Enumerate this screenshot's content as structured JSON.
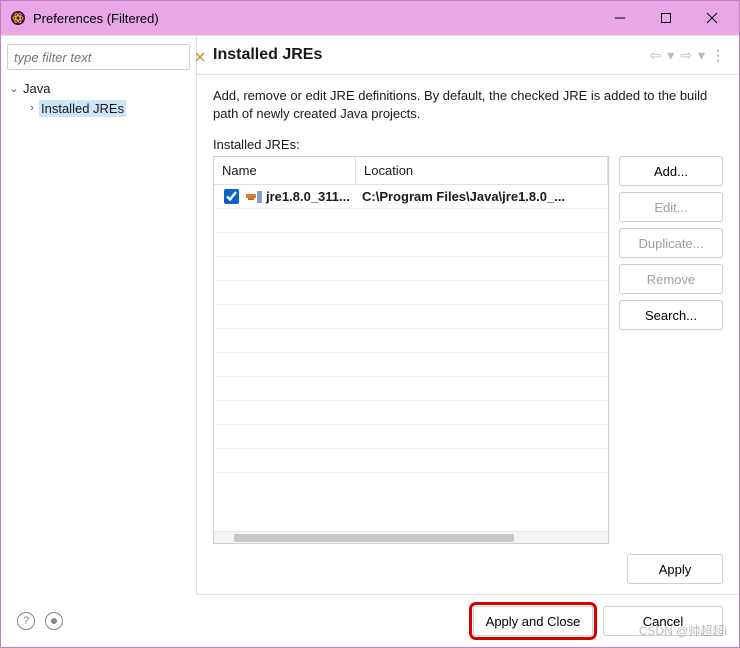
{
  "window": {
    "title": "Preferences (Filtered)"
  },
  "filter": {
    "placeholder": "type filter text"
  },
  "tree": {
    "root": {
      "label": "Java"
    },
    "child": {
      "label": "Installed JREs"
    }
  },
  "page": {
    "title": "Installed JREs",
    "description": "Add, remove or edit JRE definitions. By default, the checked JRE is added to the build path of newly created Java projects.",
    "list_label": "Installed JREs:"
  },
  "table": {
    "columns": {
      "name": "Name",
      "location": "Location"
    },
    "rows": [
      {
        "checked": true,
        "name": "jre1.8.0_311...",
        "location": "C:\\Program Files\\Java\\jre1.8.0_..."
      }
    ]
  },
  "buttons": {
    "add": "Add...",
    "edit": "Edit...",
    "duplicate": "Duplicate...",
    "remove": "Remove",
    "search": "Search...",
    "apply": "Apply",
    "apply_close": "Apply and Close",
    "cancel": "Cancel"
  },
  "watermark": "CSDN @帅超超i"
}
